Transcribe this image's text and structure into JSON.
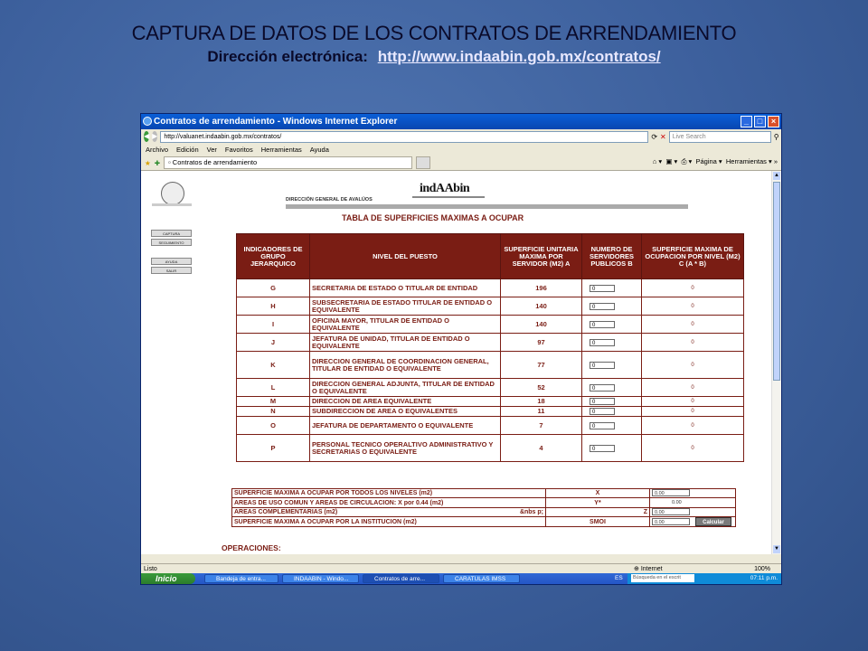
{
  "slide": {
    "title": "CAPTURA DE DATOS DE LOS CONTRATOS DE ARRENDAMIENTO",
    "subtitle_label": "Dirección electrónica:",
    "subtitle_link": "http://www.indaabin.gob.mx/contratos/"
  },
  "browser": {
    "window_title": "Contratos de arrendamiento - Windows Internet Explorer",
    "address": "http://valuanet.indaabin.gob.mx/contratos/",
    "search_placeholder": "Live Search",
    "menu": [
      "Archivo",
      "Edición",
      "Ver",
      "Favoritos",
      "Herramientas",
      "Ayuda"
    ],
    "tab_label": "Contratos de arrendamiento",
    "tools_page": "Página",
    "tools_tools": "Herramientas",
    "status_left": "Listo",
    "status_zone": "Internet",
    "status_zoom": "100%"
  },
  "page": {
    "agency": "DIRECCIÓN GENERAL DE AVALÚOS",
    "logo": "indAAbin",
    "table_title": "TABLA DE SUPERFICIES MAXIMAS A OCUPAR",
    "side_buttons": [
      "CAPTURA",
      "SEGUIMIENTO",
      "AYUDA",
      "SALIR"
    ],
    "headers": {
      "col1": "INDICADORES DE GRUPO JERARQUICO",
      "col2": "NIVEL DEL PUESTO",
      "col3": "SUPERFICIE UNITARIA MAXIMA POR SERVIDOR (M2) A",
      "col4": "NUMERO DE SERVIDORES PUBLICOS B",
      "col5": "SUPERFICIE MAXIMA DE OCUPACION POR NIVEL (M2) C (A * B)"
    },
    "rows": [
      {
        "code": "G",
        "nivel": "SECRETARIA DE ESTADO O TITULAR DE ENTIDAD",
        "sup": "196",
        "serv": "0",
        "res": "0"
      },
      {
        "code": "H",
        "nivel": "SUBSECRETARIA DE ESTADO TITULAR DE ENTIDAD O EQUIVALENTE",
        "sup": "140",
        "serv": "0",
        "res": "0"
      },
      {
        "code": "I",
        "nivel": "OFICINA MAYOR, TITULAR DE ENTIDAD O EQUIVALENTE",
        "sup": "140",
        "serv": "0",
        "res": "0"
      },
      {
        "code": "J",
        "nivel": "JEFATURA DE UNIDAD, TITULAR DE ENTIDAD O EQUIVALENTE",
        "sup": "97",
        "serv": "0",
        "res": "0"
      },
      {
        "code": "K",
        "nivel": "DIRECCION GENERAL DE COORDINACION GENERAL, TITULAR DE ENTIDAD O EQUIVALENTE",
        "sup": "77",
        "serv": "0",
        "res": "0"
      },
      {
        "code": "L",
        "nivel": "DIRECCION GENERAL ADJUNTA, TITULAR DE ENTIDAD O EQUIVALENTE",
        "sup": "52",
        "serv": "0",
        "res": "0"
      },
      {
        "code": "M",
        "nivel": "DIRECCION DE AREA EQUIVALENTE",
        "sup": "18",
        "serv": "0",
        "res": "0"
      },
      {
        "code": "N",
        "nivel": "SUBDIRECCION DE AREA O EQUIVALENTES",
        "sup": "11",
        "serv": "0",
        "res": "0"
      },
      {
        "code": "O",
        "nivel": "JEFATURA DE DEPARTAMENTO O EQUIVALENTE",
        "sup": "7",
        "serv": "0",
        "res": "0"
      },
      {
        "code": "P",
        "nivel": "PERSONAL TECNICO OPERALTIVO ADMINISTRATIVO Y SECRETARIAS O EQUIVALENTE",
        "sup": "4",
        "serv": "0",
        "res": "0"
      }
    ],
    "summary": [
      {
        "label": "SUPERFICIE MAXIMA A OCUPAR POR TODOS LOS NIVELES (m2)",
        "symbol": "X",
        "value": "0.00"
      },
      {
        "label": "AREAS DE USO COMUN Y AREAS DE CIRCULACION: X por 0.44 (m2)",
        "symbol": "Y*",
        "value": "0.00"
      },
      {
        "label": "AREAS COMPLEMENTARIAS (m2)",
        "symbol_left": "&nbs p;",
        "symbol": "Z",
        "value": "0.00"
      },
      {
        "label": "SUPERFICIE MAXIMA A OCUPAR POR LA INSTITUCION (m2)",
        "symbol": "SMOI",
        "value": "0.00",
        "button": "Calcular"
      }
    ],
    "operaciones": "OPERACIONES:"
  },
  "taskbar": {
    "start": "Inicio",
    "items": [
      "Bandeja de entra...",
      "INDAABIN - Windo...",
      "Contratos de arre...",
      "CARATULAS IMSS"
    ],
    "lang": "ES",
    "search": "Búsqueda en el escrit",
    "clock": "07:11 p.m."
  }
}
